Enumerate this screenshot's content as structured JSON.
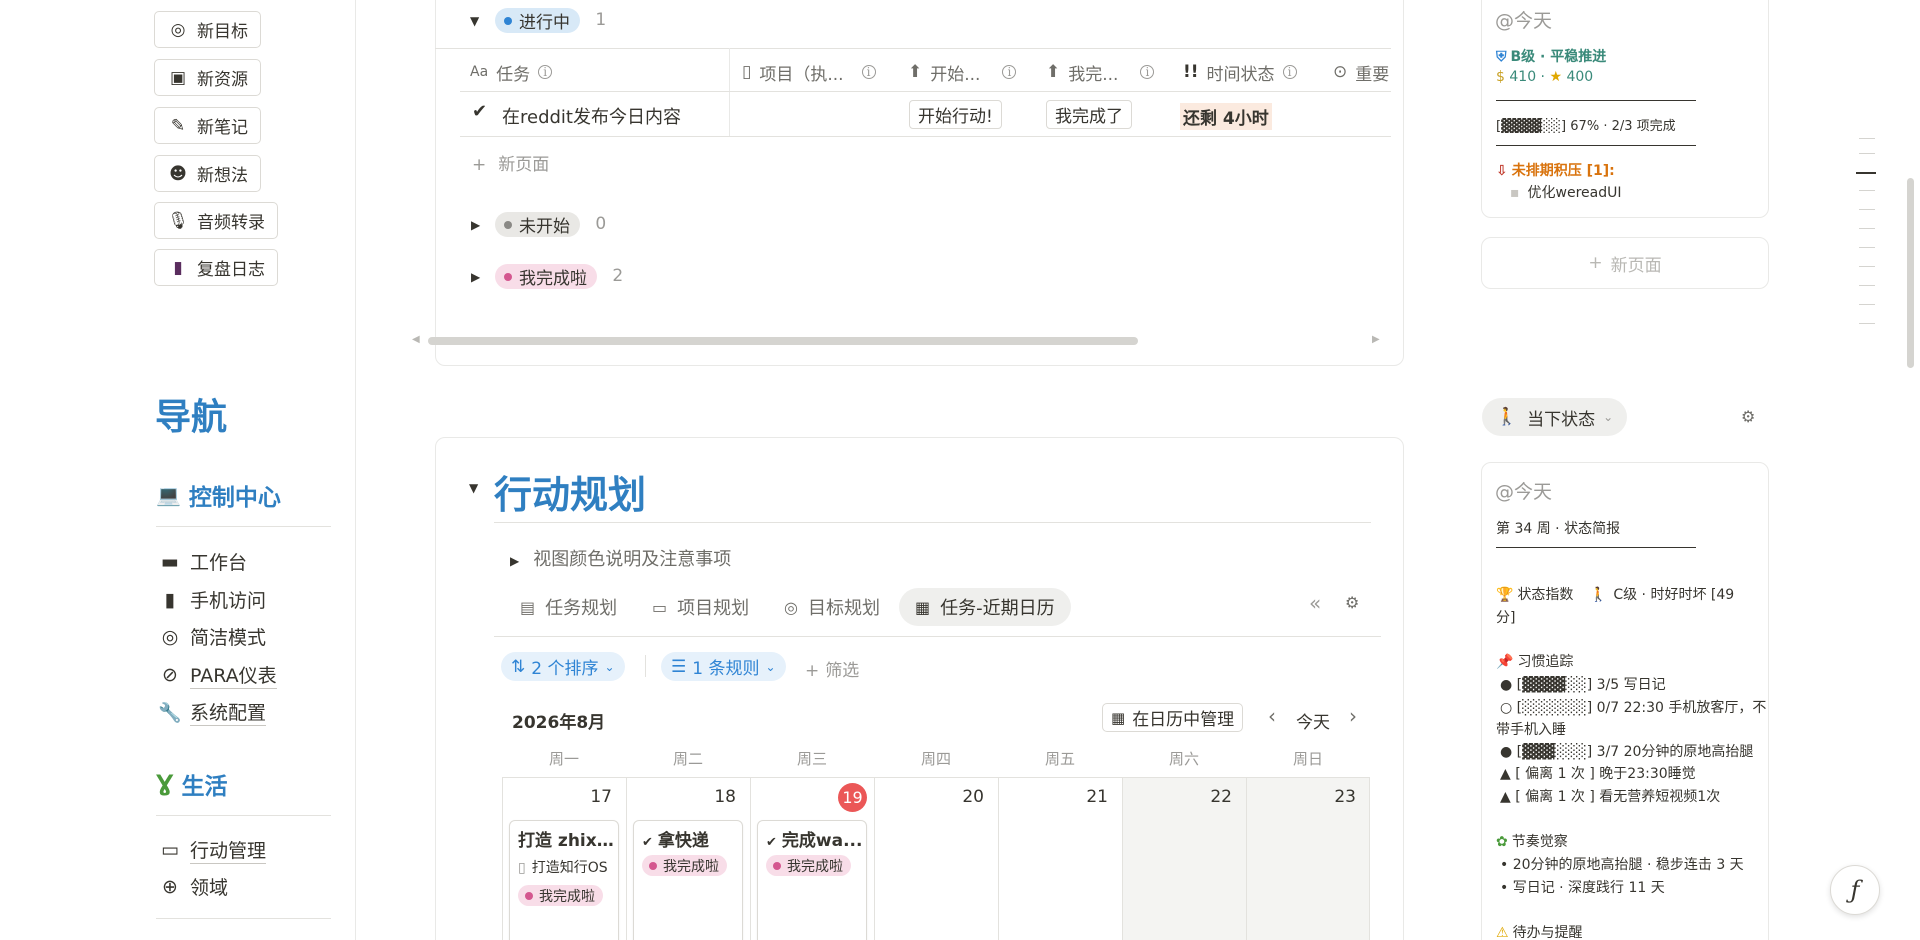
{
  "sidebar": {
    "quick_buttons": [
      {
        "label": "新目标",
        "icon": "target-icon"
      },
      {
        "label": "新资源",
        "icon": "box-icon"
      },
      {
        "label": "新笔记",
        "icon": "pencil-icon"
      },
      {
        "label": "新想法",
        "icon": "smile-icon"
      },
      {
        "label": "音频转录",
        "icon": "microphone-icon"
      },
      {
        "label": "复盘日志",
        "icon": "book-icon"
      }
    ],
    "nav_title": "导航",
    "control_center": "控制中心",
    "control_items": [
      "工作台",
      "手机访问",
      "简洁模式",
      "PARA仪表",
      "系统配置"
    ],
    "life": "生活",
    "life_items": [
      "行动管理",
      "领域"
    ]
  },
  "task_table": {
    "groups": [
      {
        "label": "进行中",
        "count": "1",
        "color": "#2f84d4",
        "bg": "#d8e9f7"
      },
      {
        "label": "未开始",
        "count": "0",
        "color": "#8a8985",
        "bg": "#e9e8e5"
      },
      {
        "label": "我完成啦",
        "count": "2",
        "color": "#d4578f",
        "bg": "#f8dde8"
      }
    ],
    "columns": [
      "任务",
      "项目（执...",
      "开始...",
      "我完...",
      "时间状态",
      "重要"
    ],
    "column_prefix": "Aa",
    "row": {
      "title": "在reddit发布今日内容",
      "start_button": "开始行动!",
      "done_button": "我完成了",
      "time_status": "还剩 4小时"
    },
    "new_page": "新页面"
  },
  "action_plan": {
    "title": "行动规划",
    "toggle": "视图颜色说明及注意事项",
    "tabs": [
      "任务规划",
      "项目规划",
      "目标规划",
      "任务-近期日历"
    ],
    "active_tab": 3,
    "sort_label": "2 个排序",
    "rule_label": "1 条规则",
    "filter_label": "筛选",
    "month": "2026年8月",
    "manage_btn": "在日历中管理",
    "today_btn": "今天",
    "weekdays": [
      "周一",
      "周二",
      "周三",
      "周四",
      "周五",
      "周六",
      "周日"
    ],
    "days": [
      "17",
      "18",
      "19",
      "20",
      "21",
      "22",
      "23"
    ],
    "today_index": 2,
    "cards": [
      {
        "title": "打造 zhixi...",
        "project": "打造知行OS",
        "status": "我完成啦"
      },
      {
        "title": "拿快递",
        "status": "我完成啦"
      },
      {
        "title": "完成wa...",
        "status": "我完成啦"
      }
    ]
  },
  "right_panel": {
    "top_card": {
      "today": "@今天",
      "level": "B级 · 平稳推进",
      "coins": "410",
      "stars": "400",
      "progress": "67%",
      "progress_bar": "[▓▓▓▓░░]",
      "progress_text": "2/3 项完成",
      "backlog": "未排期积压 [1]:",
      "backlog_item": "优化wereadUI"
    },
    "new_page": "新页面",
    "state_btn": "当下状态",
    "status_card": {
      "today": "@今天",
      "week_title": "第 34 周 · 状态简报",
      "index_label": "状态指数",
      "index_value": "C级 · 时好时坏 [49",
      "index_value2": "分]",
      "habits_title": "习惯追踪",
      "habits": [
        "● [▓▓▓▓░░] 3/5  写日记",
        "○ [░░░░░░] 0/7  22:30 手机放客厅，不",
        "带手机入睡",
        "● [▓▓▓░░░] 3/7  20分钟的原地高抬腿",
        "▲ [ 偏离 1 次 ]  晚于23:30睡觉",
        "▲ [ 偏离 1 次 ]  看无营养短视频1次"
      ],
      "rhythm_title": "节奏觉察",
      "rhythm": [
        "• 20分钟的原地高抬腿 · 稳步连击 3 天",
        "• 写日记 · 深度践行 11 天"
      ],
      "todo_title": "待办与提醒"
    }
  }
}
